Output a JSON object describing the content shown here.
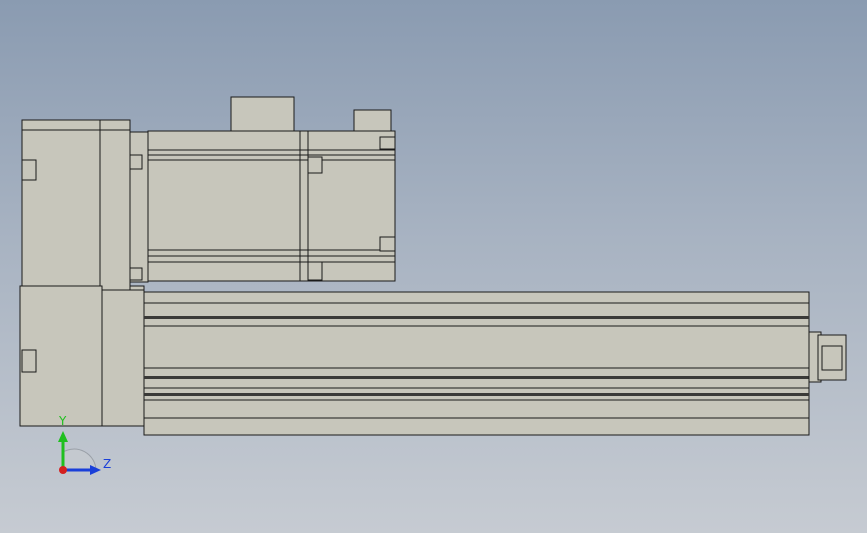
{
  "triad": {
    "y_label": "Y",
    "z_label": "Z",
    "y_color": "#1fbf1f",
    "z_color": "#1a3fd9",
    "x_color": "#d42020"
  },
  "model": {
    "body_color": "#c7c6bb",
    "edge_color": "#1a1a1a"
  },
  "background": {
    "top_color": "#8a9bb1",
    "bottom_color": "#c6cbd2"
  }
}
